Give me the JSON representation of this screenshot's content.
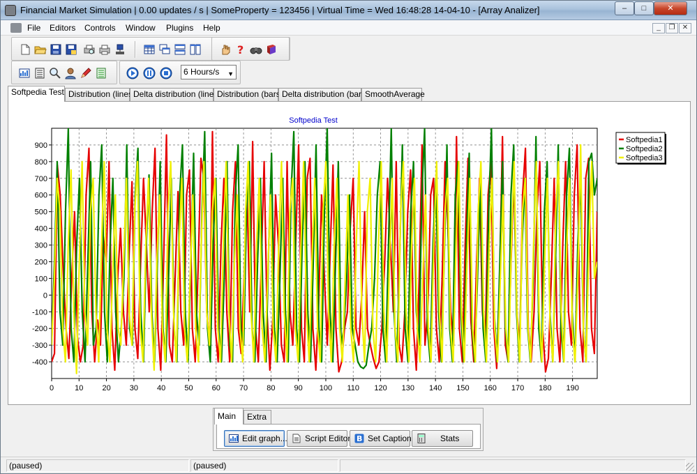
{
  "window": {
    "title": "Financial Market Simulation | 0.00 updates / s | SomeProperty = 123456 | Virtual Time = Wed    16:48:28   14-04-10  - [Array Analizer]",
    "controls": {
      "minimize": "–",
      "maximize": "□",
      "close": "✕"
    }
  },
  "menu": [
    "File",
    "Editors",
    "Controls",
    "Window",
    "Plugins",
    "Help"
  ],
  "mdi_controls": {
    "minimize": "_",
    "restore": "❐",
    "close": "✕"
  },
  "toolbar": {
    "speed": "6 Hours/s",
    "icons": {
      "new": "new-file-icon",
      "open": "open-folder-icon",
      "save": "save-icon",
      "save_as": "save-as-icon",
      "print_preview": "print-preview-icon",
      "print": "printer-icon",
      "network": "network-icon",
      "grid": "grid-icon",
      "cascade": "cascade-windows-icon",
      "tile_h": "tile-horizontal-icon",
      "tile_v": "tile-vertical-icon",
      "hand": "hand-icon",
      "help": "help-icon",
      "binoculars": "binoculars-icon",
      "book": "book-icon",
      "chart": "chart-icon",
      "list": "list-icon",
      "magnify": "magnifier-icon",
      "user": "user-icon",
      "pen": "pen-icon",
      "sheet": "sheet-icon",
      "play": "play-icon",
      "pause": "pause-icon",
      "stop": "stop-icon"
    }
  },
  "tabs": [
    "Softpedia Test",
    "Distribution (lines)",
    "Delta distribution (lines)",
    "Distribution (bars)",
    "Delta distribution (bars)",
    "SmoothAverage"
  ],
  "colors": {
    "series1": "#e60000",
    "series2": "#008000",
    "series3": "#f0f000",
    "title": "#0000cc"
  },
  "chart_data": {
    "type": "line",
    "title": "Softpedia Test",
    "xlabel": "",
    "ylabel": "",
    "xlim": [
      0,
      199
    ],
    "ylim": [
      -500,
      1000
    ],
    "xticks": [
      0,
      10,
      20,
      30,
      40,
      50,
      60,
      70,
      80,
      90,
      100,
      110,
      120,
      130,
      140,
      150,
      160,
      170,
      180,
      190
    ],
    "yticks": [
      -400,
      -300,
      -200,
      -100,
      0,
      100,
      200,
      300,
      400,
      500,
      600,
      700,
      800,
      900
    ],
    "grid": true,
    "legend": "top-right",
    "series": [
      {
        "name": "Softpedia1",
        "color": "#e60000",
        "values": [
          -400,
          -350,
          780,
          600,
          150,
          -200,
          -380,
          100,
          500,
          -250,
          -400,
          -300,
          600,
          880,
          -100,
          -400,
          -150,
          -300,
          350,
          200,
          800,
          -200,
          -450,
          100,
          400,
          -100,
          -300,
          250,
          680,
          -200,
          -380,
          200,
          700,
          300,
          -100,
          500,
          880,
          -200,
          -450,
          200,
          960,
          -300,
          -400,
          100,
          620,
          -100,
          -300,
          600,
          750,
          -200,
          -400,
          150,
          820,
          700,
          -100,
          -300,
          980,
          -200,
          -400,
          300,
          700,
          -100,
          -400,
          500,
          800,
          -200,
          -350,
          100,
          650,
          -100,
          920,
          -200,
          -400,
          200,
          800,
          -100,
          -450,
          -150,
          600,
          300,
          -300,
          -400,
          800,
          -100,
          -300,
          300,
          900,
          -200,
          -400,
          700,
          820,
          -200,
          -450,
          -50,
          600,
          100,
          -300,
          250,
          780,
          -200,
          -460,
          -400,
          -200,
          -100,
          400,
          700,
          -200,
          -300,
          0,
          500,
          -200,
          -300,
          -380,
          -440,
          -400,
          -200,
          200,
          700,
          300,
          -100,
          800,
          -300,
          -400,
          -100,
          500,
          750,
          -200,
          -450,
          100,
          900,
          -300,
          -100,
          600,
          700,
          -200,
          -400,
          100,
          800,
          400,
          -100,
          -300,
          950,
          -200,
          -400,
          300,
          820,
          -150,
          -400,
          200,
          700,
          -100,
          -300,
          600,
          800,
          -200,
          -440,
          100,
          950,
          -300,
          -400,
          200,
          700,
          -100,
          -300,
          600,
          880,
          -200,
          -400,
          -100,
          500,
          800,
          -200,
          -460,
          -380,
          100,
          700,
          -200,
          -400,
          300,
          800,
          -100,
          -300,
          600,
          900,
          -200,
          -400,
          700,
          820,
          -200,
          -350,
          500
        ]
      },
      {
        "name": "Softpedia2",
        "color": "#008000",
        "values": [
          -300,
          200,
          800,
          -100,
          -300,
          500,
          1000,
          -200,
          -400,
          300,
          700,
          -100,
          -400,
          200,
          800,
          -300,
          -200,
          600,
          900,
          -100,
          -400,
          300,
          700,
          -100,
          -400,
          -200,
          100,
          900,
          -200,
          -300,
          600,
          880,
          -100,
          -400,
          300,
          720,
          -100,
          -400,
          200,
          800,
          -200,
          -400,
          100,
          700,
          -200,
          -400,
          600,
          900,
          -100,
          -400,
          200,
          850,
          -100,
          -300,
          500,
          980,
          -200,
          -400,
          300,
          700,
          -200,
          -400,
          100,
          800,
          -300,
          -400,
          600,
          900,
          -200,
          -300,
          500,
          800,
          -200,
          -400,
          200,
          700,
          -100,
          -400,
          300,
          850,
          -200,
          -400,
          100,
          700,
          -100,
          -400,
          600,
          980,
          -200,
          -400,
          300,
          800,
          -100,
          -400,
          200,
          900,
          -200,
          -400,
          500,
          1000,
          -100,
          -400,
          200,
          800,
          -300,
          -200,
          100,
          600,
          -200,
          -300,
          -400,
          -430,
          -440,
          -420,
          -300,
          -200,
          100,
          600,
          800,
          -200,
          -400,
          300,
          1000,
          -100,
          -400,
          200,
          900,
          -200,
          -400,
          500,
          800,
          -100,
          -300,
          600,
          1000,
          -200,
          -400,
          300,
          700,
          -100,
          -400,
          200,
          900,
          -200,
          -400,
          600,
          800,
          -100,
          -400,
          300,
          850,
          -200,
          -400,
          100,
          700,
          -200,
          -400,
          500,
          1000,
          -100,
          -400,
          200,
          800,
          -200,
          -400,
          600,
          900,
          -100,
          -400,
          300,
          700,
          -200,
          -400,
          100,
          950,
          -200,
          -400,
          500,
          800,
          -100,
          -400,
          200,
          900,
          -200,
          -400,
          600,
          880,
          -100,
          -400,
          300,
          700,
          -200,
          -400,
          800,
          850,
          600,
          700
        ]
      },
      {
        "name": "Softpedia3",
        "color": "#f0f000",
        "values": [
          -300,
          100,
          700,
          500,
          -200,
          -400,
          300,
          750,
          -100,
          -470,
          200,
          800,
          -100,
          -300,
          500,
          700,
          -100,
          -400,
          300,
          800,
          -200,
          -400,
          100,
          600,
          -200,
          -300,
          200,
          700,
          -100,
          -300,
          500,
          800,
          -200,
          -400,
          300,
          700,
          -100,
          -450,
          200,
          600,
          -200,
          -400,
          500,
          800,
          -100,
          -400,
          300,
          700,
          -200,
          -400,
          100,
          600,
          -200,
          -400,
          300,
          800,
          -100,
          -300,
          500,
          700,
          -200,
          -400,
          300,
          800,
          -100,
          -400,
          200,
          600,
          -200,
          -400,
          500,
          800,
          -100,
          -400,
          300,
          700,
          -200,
          -400,
          100,
          600,
          -200,
          -400,
          300,
          800,
          -100,
          -400,
          500,
          700,
          -200,
          -400,
          300,
          800,
          -100,
          -400,
          200,
          700,
          -200,
          -400,
          500,
          800,
          -100,
          -400,
          300,
          700,
          -200,
          -400,
          100,
          600,
          -200,
          -400,
          300,
          800,
          -100,
          -400,
          500,
          700,
          -200,
          -400,
          300,
          800,
          -100,
          -400,
          200,
          700,
          -200,
          -400,
          500,
          800,
          -100,
          -400,
          300,
          700,
          -200,
          -400,
          100,
          600,
          -200,
          -400,
          300,
          800,
          -100,
          -400,
          500,
          700,
          -200,
          -400,
          300,
          800,
          -100,
          -400,
          200,
          700,
          -200,
          -400,
          500,
          800,
          -100,
          -400,
          300,
          700,
          -200,
          -400,
          100,
          600,
          -200,
          -400,
          300,
          800,
          -100,
          -400,
          500,
          700,
          -200,
          -400,
          300,
          800,
          -100,
          -400,
          200,
          700,
          -200,
          -400,
          500,
          800,
          -100,
          -400,
          300,
          700,
          -200,
          -400,
          100,
          900,
          -200,
          -400,
          300,
          800,
          100,
          200
        ]
      }
    ]
  },
  "bottom_tabs": [
    "Main",
    "Extra"
  ],
  "buttons": {
    "edit_graph": "Edit graph...",
    "script_editor": "Script Editor",
    "set_caption": "Set Caption",
    "stats": "Stats"
  },
  "status": [
    "(paused)",
    "(paused)"
  ]
}
